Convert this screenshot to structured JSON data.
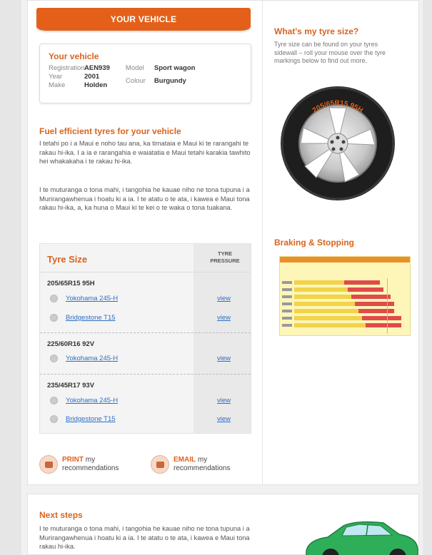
{
  "banner": {
    "label": "YOUR VEHICLE"
  },
  "vehicle": {
    "title": "Your vehicle",
    "fields": {
      "registration": {
        "label": "Registration",
        "value": "AEN939"
      },
      "year": {
        "label": "Year",
        "value": "2001"
      },
      "make": {
        "label": "Make",
        "value": "Holden"
      },
      "model": {
        "label": "Model",
        "value": "Sport wagon"
      },
      "colour": {
        "label": "Colour",
        "value": "Burgundy"
      }
    }
  },
  "fuel": {
    "title": "Fuel efficient tyres for your vehicle",
    "p1": "I tetahi po i a Maui e noho tau ana, ka timataia e Maui ki te rarangahi te rakau hi-ika. I a ia e rarangahia e waiatatia e Maui tetahi karakia tawhito hei whakakaha i te rakau hi-ika.",
    "p2": "I te muturanga o tona mahi, i tangohia he kauae niho ne tona tupuna i a Murirangawhenua i hoatu ki a ia. I te atatu o te ata, i kawea e Maui tona rakau hi-ika, a, ka huna o Maui ki te kei o te waka o tona tuakana."
  },
  "tyres": {
    "title": "Tyre Size",
    "pressure_header": "TYRE PRESSURE",
    "groups": [
      {
        "size": "205/65R15 95H",
        "options": [
          {
            "name": "Yokohama 245-H",
            "action": "view"
          },
          {
            "name": "Bridgestone T15",
            "action": "view"
          }
        ]
      },
      {
        "size": "225/60R16 92V",
        "options": [
          {
            "name": "Yokohama 245-H",
            "action": "view"
          }
        ]
      },
      {
        "size": "235/45R17 93V",
        "options": [
          {
            "name": "Yokohama 245-H",
            "action": "view"
          },
          {
            "name": "Bridgestone T15",
            "action": "view"
          }
        ]
      }
    ]
  },
  "actions": {
    "print": {
      "strong": "PRINT",
      "rest1": " my",
      "rest2": "recommendations"
    },
    "email": {
      "strong": "EMAIL",
      "rest1": " my",
      "rest2": "recommendations"
    }
  },
  "sidebar": {
    "tyre_size_title": "What's my tyre size?",
    "tyre_size_text": "Tyre size can be found on your tyres sidewall – roll your mouse over the tyre markings below to find out more.",
    "tyre_marking": "205/65R15 95H",
    "braking_title": "Braking & Stopping"
  },
  "next_steps": {
    "title": "Next steps",
    "text": "I te muturanga o tona mahi, i tangohia he kauae niho ne tona tupuna i a Murirangawhenua i hoatu ki a ia. I te atatu o te ata, i kawea e Maui tona rakau hi-ika."
  },
  "colors": {
    "accent": "#e4601a",
    "link": "#2c6fc4"
  }
}
